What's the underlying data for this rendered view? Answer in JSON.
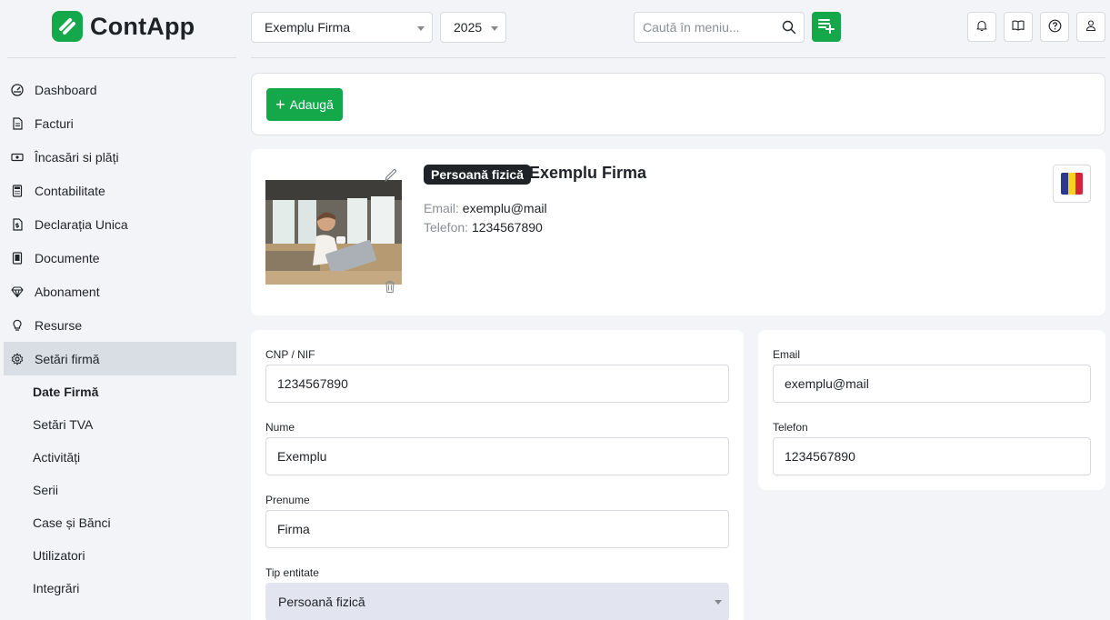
{
  "app": {
    "name": "ContApp"
  },
  "topbar": {
    "company_select": "Exemplu Firma",
    "year_select": "2025",
    "search_placeholder": "Caută în meniu..."
  },
  "sidebar": {
    "items": [
      {
        "label": "Dashboard",
        "icon": "gauge-icon"
      },
      {
        "label": "Facturi",
        "icon": "document-icon"
      },
      {
        "label": "Încasări si plăți",
        "icon": "cash-icon"
      },
      {
        "label": "Contabilitate",
        "icon": "calculator-icon"
      },
      {
        "label": "Declarația Unica",
        "icon": "file-dollar-icon"
      },
      {
        "label": "Documente",
        "icon": "file-icon"
      },
      {
        "label": "Abonament",
        "icon": "diamond-icon"
      },
      {
        "label": "Resurse",
        "icon": "lightbulb-icon"
      },
      {
        "label": "Setări firmă",
        "icon": "gear-icon"
      }
    ],
    "subitems": [
      {
        "label": "Date Firmă"
      },
      {
        "label": "Setări TVA"
      },
      {
        "label": "Activități"
      },
      {
        "label": "Serii"
      },
      {
        "label": "Case și Bănci"
      },
      {
        "label": "Utilizatori"
      },
      {
        "label": "Integrări"
      }
    ]
  },
  "actions": {
    "add_label": "Adaugă"
  },
  "profile": {
    "badge": "Persoană fizică",
    "title": "Exemplu Firma",
    "email_key": "Email:",
    "email_value": "exemplu@mail",
    "phone_key": "Telefon:",
    "phone_value": "1234567890"
  },
  "form": {
    "cnp_label": "CNP / NIF",
    "cnp_value": "1234567890",
    "nume_label": "Nume",
    "nume_value": "Exemplu",
    "prenume_label": "Prenume",
    "prenume_value": "Firma",
    "tip_label": "Tip entitate",
    "tip_value": "Persoană fizică"
  },
  "contact": {
    "email_label": "Email",
    "email_value": "exemplu@mail",
    "phone_label": "Telefon",
    "phone_value": "1234567890"
  },
  "colors": {
    "accent": "#14a84b",
    "dark": "#1f2328",
    "active_nav": "#d9dee4"
  }
}
